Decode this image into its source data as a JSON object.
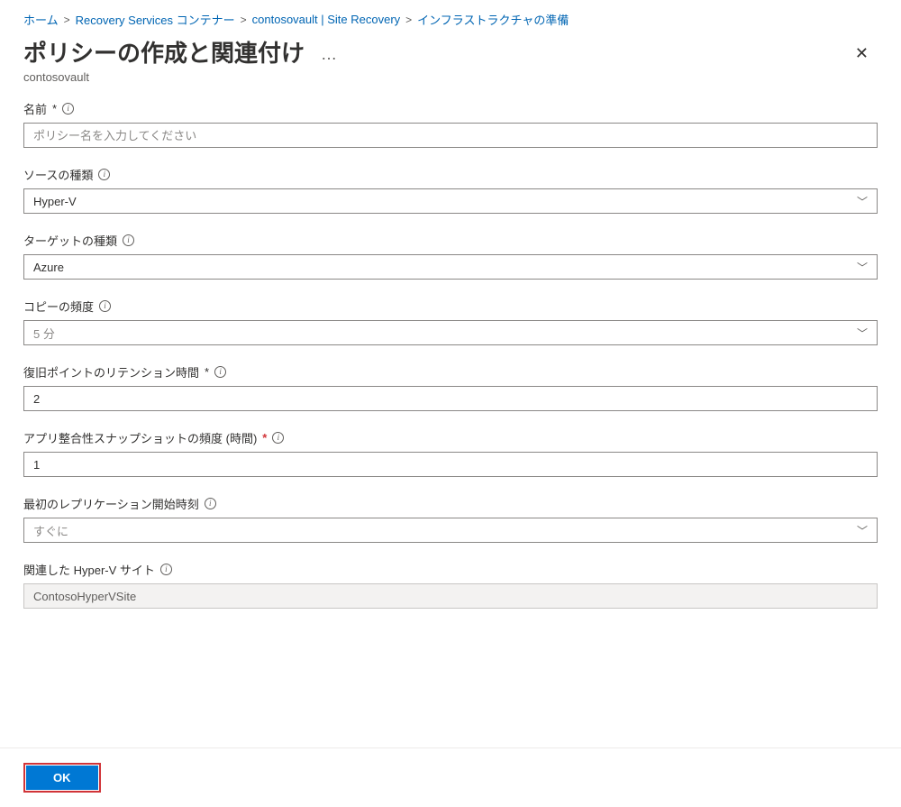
{
  "breadcrumb": {
    "home": "ホーム",
    "vaults": "Recovery Services コンテナー",
    "vault": "contosovault | Site Recovery",
    "prep": "インフラストラクチャの準備"
  },
  "header": {
    "title": "ポリシーの作成と関連付け",
    "ellipsis": "…",
    "subtitle": "contosovault",
    "close": "✕"
  },
  "fields": {
    "name": {
      "label": "名前",
      "req": "*",
      "placeholder": "ポリシー名を入力してください"
    },
    "sourceType": {
      "label": "ソースの種類",
      "value": "Hyper-V"
    },
    "targetType": {
      "label": "ターゲットの種類",
      "value": "Azure"
    },
    "copyFreq": {
      "label": "コピーの頻度",
      "value": "5 分"
    },
    "retention": {
      "label": "復旧ポイントのリテンション時間",
      "req": "*",
      "value": "2"
    },
    "appSnapshot": {
      "label": "アプリ整合性スナップショットの頻度 (時間)",
      "req": "*",
      "value": "1"
    },
    "startTime": {
      "label": "最初のレプリケーション開始時刻",
      "value": "すぐに"
    },
    "site": {
      "label": "関連した Hyper-V サイト",
      "value": "ContosoHyperVSite"
    }
  },
  "footer": {
    "ok": "OK"
  },
  "icons": {
    "info": "i",
    "chevron": "﹀"
  }
}
